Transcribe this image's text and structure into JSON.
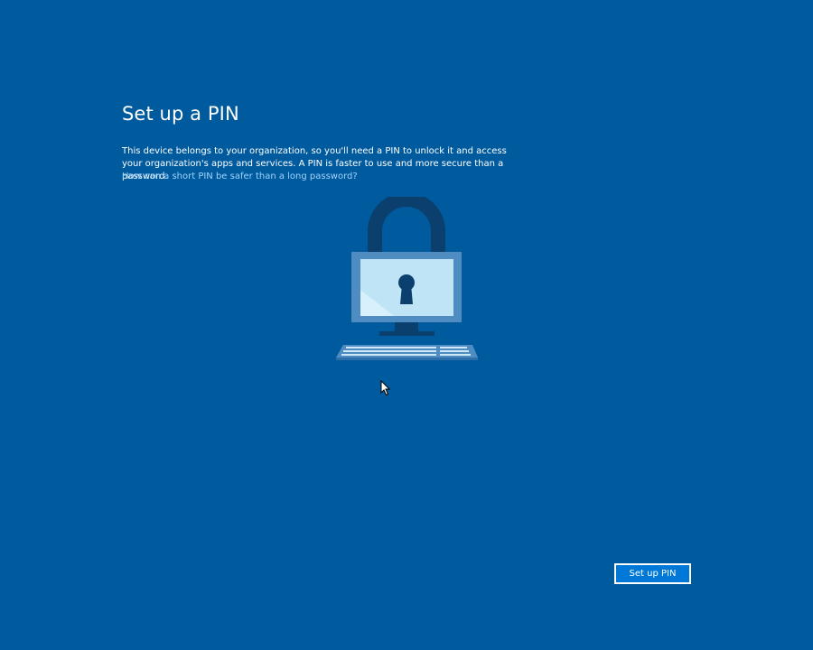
{
  "page": {
    "title": "Set up a PIN",
    "description": "This device belongs to your organization, so you'll need a PIN to unlock it and access your organization's apps and services. A PIN is faster to use and more secure than a password.",
    "help_link": "How can a short PIN be safer than a long password?"
  },
  "actions": {
    "setup_pin_label": "Set up PIN"
  },
  "icons": {
    "illustration": "pc-with-padlock-icon",
    "cursor": "mouse-pointer-icon"
  },
  "colors": {
    "background": "#005a9e",
    "link": "#9fd4ff",
    "button": "#0078d7"
  }
}
